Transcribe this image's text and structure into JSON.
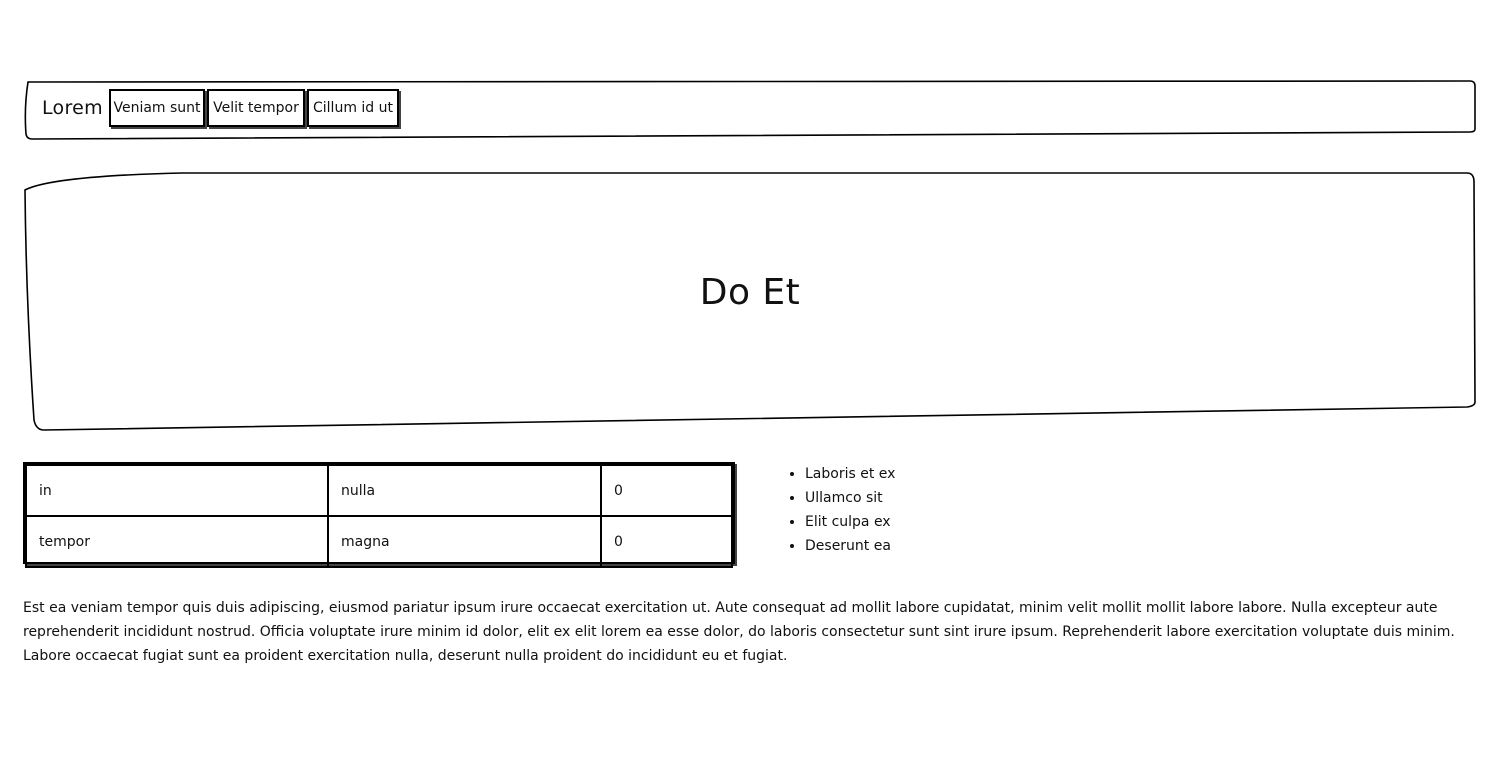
{
  "header": {
    "brand": "Lorem",
    "nav": [
      "Veniam sunt",
      "Velit tempor",
      "Cillum id ut"
    ]
  },
  "hero": {
    "title": "Do Et"
  },
  "table": {
    "rows": [
      [
        "in",
        "nulla",
        "0"
      ],
      [
        "tempor",
        "magna",
        "0"
      ]
    ]
  },
  "list": {
    "items": [
      "Laboris et ex",
      "Ullamco sit",
      "Elit culpa ex",
      "Deserunt ea"
    ]
  },
  "paragraph": "Est ea veniam tempor quis duis adipiscing, eiusmod pariatur ipsum irure occaecat exercitation ut. Aute consequat ad mollit labore cupidatat, minim velit mollit mollit labore labore. Nulla excepteur aute reprehenderit incididunt nostrud. Officia voluptate irure minim id dolor, elit ex elit lorem ea esse dolor, do laboris consectetur sunt sint irure ipsum. Reprehenderit labore exercitation voluptate duis minim. Labore occaecat fugiat sunt ea proident exercitation nulla, deserunt nulla proident do incididunt eu et fugiat."
}
